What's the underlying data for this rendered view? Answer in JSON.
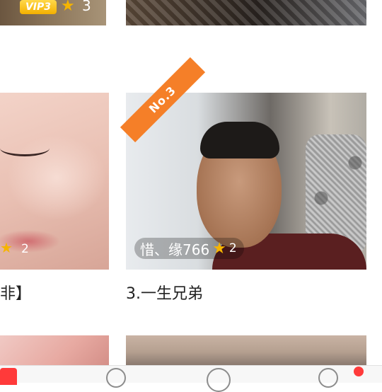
{
  "top_row": {
    "left": {
      "vip_label": "VIP3",
      "rating": "3"
    }
  },
  "cards": [
    {
      "rating": "2",
      "title": "非】"
    },
    {
      "rank_label": "No.3",
      "username": "惜、缘766",
      "rating": "2",
      "title": "3.一生兄弟"
    }
  ],
  "colors": {
    "accent": "#f57f28",
    "star": "#f6b400",
    "notification": "#ff3b3b"
  }
}
